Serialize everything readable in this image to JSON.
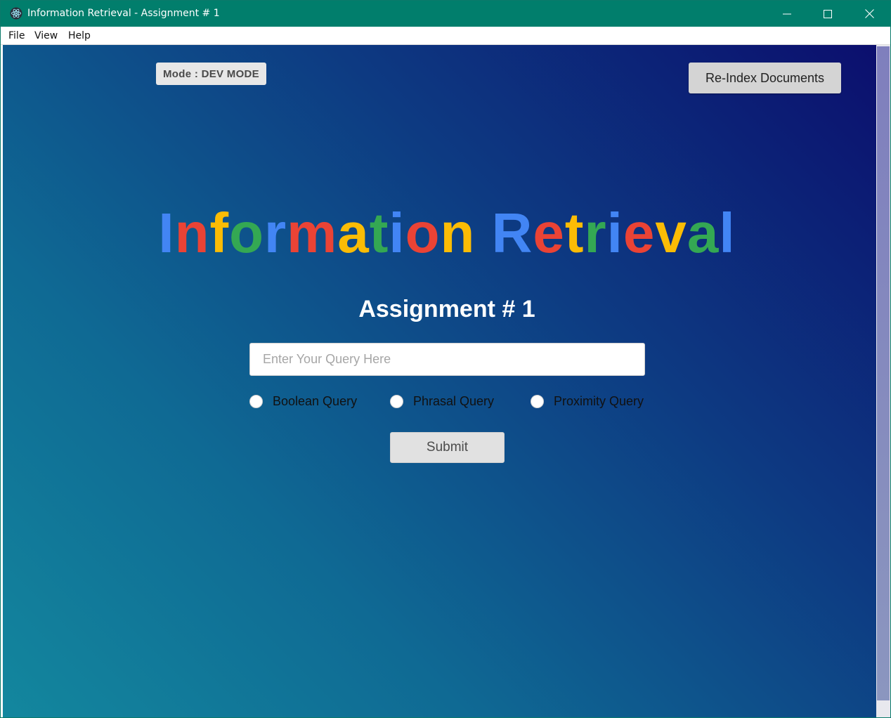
{
  "window": {
    "title": "Information Retrieval - Assignment # 1",
    "titlebar_color": "#017e6c",
    "app_icon": "electron-icon",
    "controls": [
      "minimize-icon",
      "maximize-icon",
      "close-icon"
    ]
  },
  "menu": {
    "items": [
      "File",
      "View",
      "Help"
    ]
  },
  "header": {
    "mode_label": "Mode : DEV MODE",
    "reindex_label": "Re-Index Documents"
  },
  "hero": {
    "title_text": "Information Retrieval",
    "letters": [
      {
        "ch": "I",
        "color": "#4285f4"
      },
      {
        "ch": "n",
        "color": "#ea4335"
      },
      {
        "ch": "f",
        "color": "#fbbc05"
      },
      {
        "ch": "o",
        "color": "#34a853"
      },
      {
        "ch": "r",
        "color": "#4285f4"
      },
      {
        "ch": "m",
        "color": "#ea4335"
      },
      {
        "ch": "a",
        "color": "#fbbc05"
      },
      {
        "ch": "t",
        "color": "#34a853"
      },
      {
        "ch": "i",
        "color": "#4285f4"
      },
      {
        "ch": "o",
        "color": "#ea4335"
      },
      {
        "ch": "n",
        "color": "#fbbc05"
      },
      {
        "ch": " ",
        "color": "#ffffff"
      },
      {
        "ch": "R",
        "color": "#4285f4"
      },
      {
        "ch": "e",
        "color": "#ea4335"
      },
      {
        "ch": "t",
        "color": "#fbbc05"
      },
      {
        "ch": "r",
        "color": "#34a853"
      },
      {
        "ch": "i",
        "color": "#4285f4"
      },
      {
        "ch": "e",
        "color": "#ea4335"
      },
      {
        "ch": "v",
        "color": "#fbbc05"
      },
      {
        "ch": "a",
        "color": "#34a853"
      },
      {
        "ch": "l",
        "color": "#4285f4"
      }
    ],
    "subtitle": "Assignment # 1"
  },
  "form": {
    "query_placeholder": "Enter Your Query Here",
    "query_value": "",
    "query_types": [
      {
        "label": "Boolean Query",
        "selected": false
      },
      {
        "label": "Phrasal Query",
        "selected": false
      },
      {
        "label": "Proximity Query",
        "selected": false
      }
    ],
    "submit_label": "Submit"
  },
  "theme": {
    "gradient_start": "#0c0f6e",
    "gradient_end": "#13879e"
  }
}
